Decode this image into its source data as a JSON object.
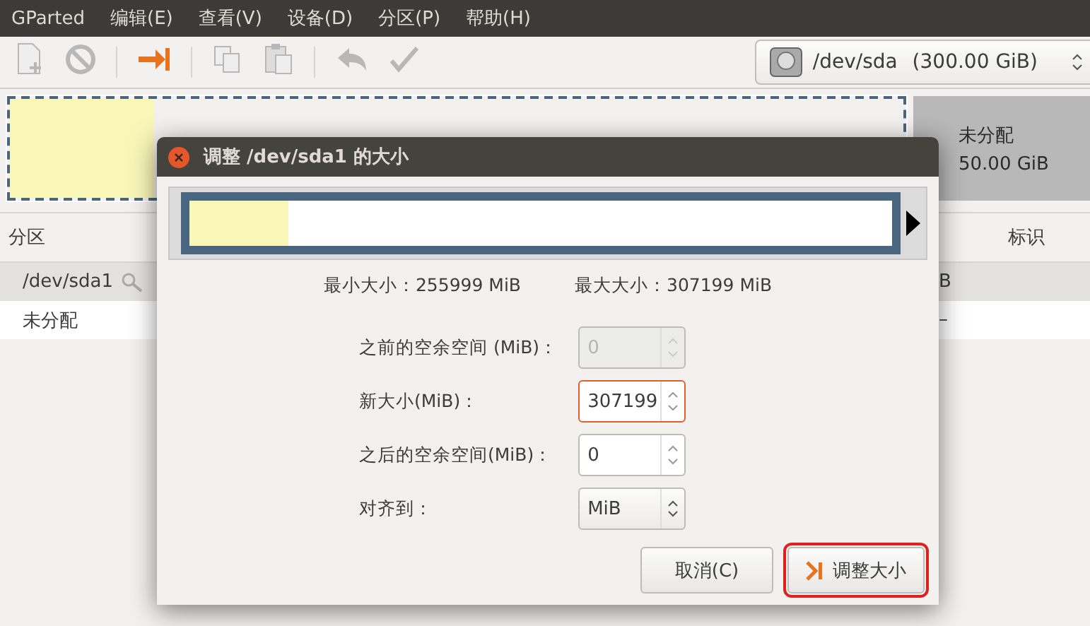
{
  "menu_bar": {
    "app_name": "GParted",
    "items": [
      "编辑(E)",
      "查看(V)",
      "设备(D)",
      "分区(P)",
      "帮助(H)"
    ]
  },
  "toolbar": {
    "tools": [
      {
        "kind": "new",
        "enabled": false
      },
      {
        "kind": "delete",
        "enabled": false
      },
      {
        "kind": "resize",
        "enabled": true
      },
      {
        "kind": "copy",
        "enabled": false
      },
      {
        "kind": "paste",
        "enabled": false
      },
      {
        "kind": "undo",
        "enabled": false
      },
      {
        "kind": "apply",
        "enabled": false
      }
    ],
    "device": {
      "name": "/dev/sda",
      "size": "(300.00 GiB)"
    }
  },
  "partition_map": {
    "unallocated": {
      "label": "未分配",
      "size": "50.00 GiB"
    }
  },
  "partition_list": {
    "columns": [
      "分区",
      "标识"
    ],
    "rows": [
      {
        "name": "/dev/sda1",
        "locked": true,
        "column_3": "B",
        "selected": true
      },
      {
        "name": "未分配",
        "locked": false,
        "column_3": "–",
        "selected": false
      }
    ]
  },
  "dialog": {
    "title": "调整 /dev/sda1 的大小",
    "partition_graphic": {
      "level": 0.14
    },
    "min_size": "最小大小：255999 MiB",
    "max_size": "最大大小：307199 MiB",
    "fields": [
      {
        "kind": "spin",
        "label": "之前的空余空间 (MiB)：",
        "value": "0",
        "disabled": true,
        "focused": false
      },
      {
        "kind": "spin",
        "label": "新大小(MiB)：",
        "value": "307199",
        "disabled": false,
        "focused": true
      },
      {
        "kind": "spin",
        "label": "之后的空余空间(MiB)：",
        "value": "0",
        "disabled": false,
        "focused": false
      },
      {
        "kind": "combo",
        "label": "对齐到：",
        "value": "MiB",
        "disabled": false,
        "focused": false
      }
    ],
    "buttons": [
      {
        "kind": "cancel",
        "label": "取消(C)",
        "highlighted": false
      },
      {
        "kind": "resize",
        "label": "调整大小",
        "highlighted": true
      }
    ]
  }
}
